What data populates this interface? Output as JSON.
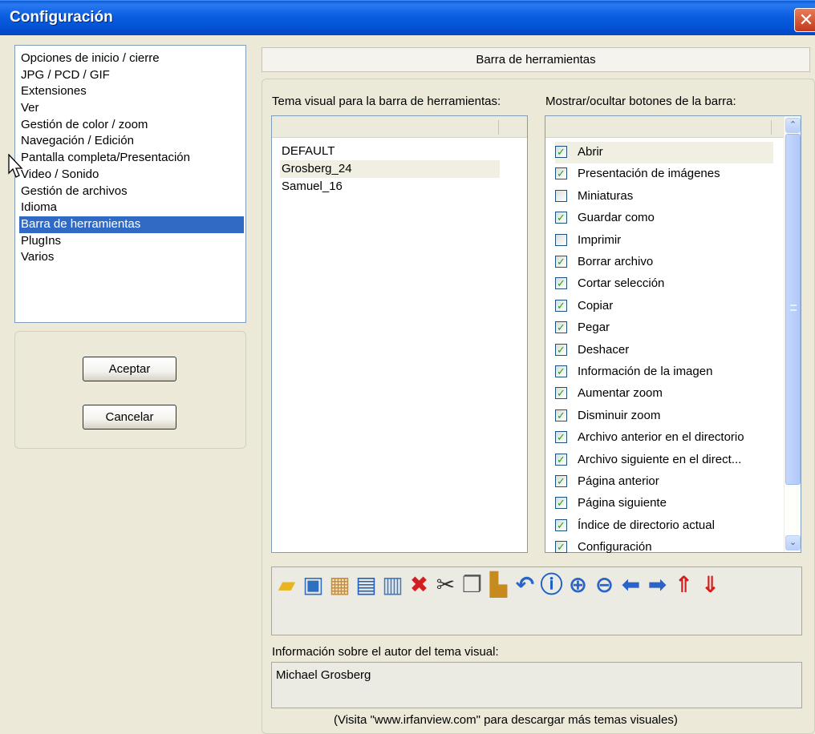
{
  "window": {
    "title": "Configuración",
    "close_glyph": "✕"
  },
  "nav": {
    "items": [
      "Opciones de inicio / cierre",
      "JPG / PCD / GIF",
      "Extensiones",
      "Ver",
      "Gestión de color / zoom",
      "Navegación / Edición",
      "Pantalla completa/Presentación",
      "Video / Sonido",
      "Gestión de archivos",
      "Idioma",
      "Barra de herramientas",
      "PlugIns",
      "Varios"
    ],
    "selected_index": 10
  },
  "buttons": {
    "accept": "Aceptar",
    "cancel": "Cancelar"
  },
  "section": {
    "title": "Barra de herramientas"
  },
  "themes": {
    "label": "Tema visual para la barra de herramientas:",
    "items": [
      "DEFAULT",
      "Grosberg_24",
      "Samuel_16"
    ],
    "selected_index": 1
  },
  "buttons_list": {
    "label": "Mostrar/ocultar botones de la barra:",
    "selected_index": 0,
    "items": [
      {
        "label": "Abrir",
        "checked": true
      },
      {
        "label": "Presentación de imágenes",
        "checked": true
      },
      {
        "label": "Miniaturas",
        "checked": false
      },
      {
        "label": "Guardar como",
        "checked": true
      },
      {
        "label": "Imprimir",
        "checked": false
      },
      {
        "label": "Borrar archivo",
        "checked": true
      },
      {
        "label": "Cortar selección",
        "checked": true
      },
      {
        "label": "Copiar",
        "checked": true
      },
      {
        "label": "Pegar",
        "checked": true
      },
      {
        "label": "Deshacer",
        "checked": true
      },
      {
        "label": "Información de la imagen",
        "checked": true
      },
      {
        "label": "Aumentar zoom",
        "checked": true
      },
      {
        "label": "Disminuir zoom",
        "checked": true
      },
      {
        "label": "Archivo anterior en el directorio",
        "checked": true
      },
      {
        "label": "Archivo siguiente en el direct...",
        "checked": true
      },
      {
        "label": "Página anterior",
        "checked": true
      },
      {
        "label": "Página siguiente",
        "checked": true
      },
      {
        "label": "Índice de directorio actual",
        "checked": true
      },
      {
        "label": "Configuración",
        "checked": true
      }
    ]
  },
  "toolbar_preview": {
    "icons": [
      {
        "name": "open-folder-icon",
        "glyph": "▰",
        "color": "#e8b520"
      },
      {
        "name": "slideshow-icon",
        "glyph": "▣",
        "color": "#2e6fc0"
      },
      {
        "name": "thumbnails-icon",
        "glyph": "▦",
        "color": "#d88a20"
      },
      {
        "name": "save-icon",
        "glyph": "▤",
        "color": "#1d5fc4"
      },
      {
        "name": "print-icon",
        "glyph": "▥",
        "color": "#3a7ad0"
      },
      {
        "name": "delete-icon",
        "glyph": "✖",
        "color": "#d21e1e"
      },
      {
        "name": "cut-icon",
        "glyph": "✂",
        "color": "#333333"
      },
      {
        "name": "copy-icon",
        "glyph": "❐",
        "color": "#555555"
      },
      {
        "name": "paste-icon",
        "glyph": "▙",
        "color": "#c68a1e"
      },
      {
        "name": "undo-icon",
        "glyph": "↶",
        "color": "#2a64c8"
      },
      {
        "name": "info-icon",
        "glyph": "ⓘ",
        "color": "#1d5fc4"
      },
      {
        "name": "zoom-in-icon",
        "glyph": "⊕",
        "color": "#2a64c8"
      },
      {
        "name": "zoom-out-icon",
        "glyph": "⊖",
        "color": "#2a64c8"
      },
      {
        "name": "arrow-left-icon",
        "glyph": "⬅",
        "color": "#2a64c8"
      },
      {
        "name": "arrow-right-icon",
        "glyph": "➡",
        "color": "#2a64c8"
      },
      {
        "name": "page-previous-icon",
        "glyph": "⇑",
        "color": "#d21e1e"
      },
      {
        "name": "page-next-icon",
        "glyph": "⇓",
        "color": "#d21e1e"
      }
    ]
  },
  "author": {
    "label": "Información sobre el autor del tema visual:",
    "value": "Michael Grosberg"
  },
  "footer": {
    "text": "(Visita \"www.irfanview.com\" para descargar más temas visuales)"
  },
  "colors": {
    "selection": "#316ac5",
    "check": "#21a121",
    "titlebar": "#0a5ee0"
  }
}
